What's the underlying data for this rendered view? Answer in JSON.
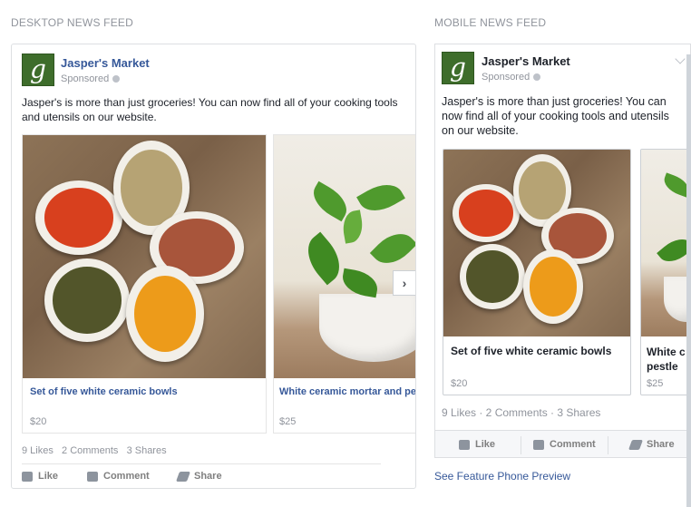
{
  "sections": {
    "desktop_label": "DESKTOP NEWS FEED",
    "mobile_label": "MOBILE NEWS FEED"
  },
  "post": {
    "page_name": "Jasper's Market",
    "logo_letter": "g",
    "sponsored": "Sponsored",
    "text_line1": "Jasper's is more than just groceries! You can now find all of your cooking tools",
    "text_line2": "and utensils on our website.",
    "mobile_text_line1": "Jasper's is more than just groceries! You can",
    "mobile_text_line2": "now find all of your cooking tools and utensils",
    "mobile_text_line3": "on our website."
  },
  "carousel": [
    {
      "title": "Set of five white ceramic bowls",
      "price": "$20"
    },
    {
      "title": "White ceramic mortar and pe",
      "price": "$25"
    }
  ],
  "mobile_carousel": [
    {
      "title": "Set of five white ceramic bowls",
      "price": "$20"
    },
    {
      "title_line1": "White c",
      "title_line2": "pestle",
      "price": "$25"
    }
  ],
  "desktop_stats": {
    "likes": "9 Likes",
    "comments": "2 Comments",
    "shares": "3 Shares"
  },
  "mobile_stats": "9 Likes · 2 Comments · 3 Shares",
  "actions": {
    "like": "Like",
    "comment": "Comment",
    "share": "Share"
  },
  "next_arrow": "›",
  "feature_phone_link": "See Feature Phone Preview",
  "colors": {
    "link": "#365899",
    "logo_green": "#3e6d2b",
    "muted": "#90949c"
  }
}
